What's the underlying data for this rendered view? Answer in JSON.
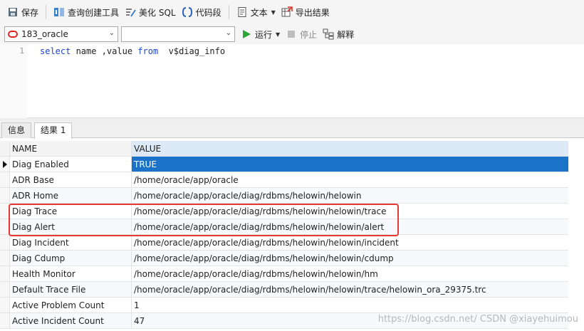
{
  "toolbar": {
    "save": "保存",
    "query_builder": "查询创建工具",
    "beautify_sql": "美化 SQL",
    "code_snippet": "代码段",
    "text": "文本",
    "export_results": "导出结果"
  },
  "toolbar2": {
    "connection": "183_oracle",
    "schema": "",
    "run": "运行",
    "stop": "停止",
    "explain": "解释"
  },
  "editor": {
    "line_number": "1",
    "tokens": [
      {
        "text": "select",
        "kw": true
      },
      {
        "text": " name ,value ",
        "kw": false
      },
      {
        "text": "from",
        "kw": true
      },
      {
        "text": "  v$diag_info",
        "kw": false
      }
    ]
  },
  "tabs": [
    {
      "label": "信息",
      "active": false
    },
    {
      "label": "结果 1",
      "active": true
    }
  ],
  "grid": {
    "columns": [
      "NAME",
      "VALUE"
    ],
    "rows": [
      {
        "name": "Diag Enabled",
        "value": "TRUE"
      },
      {
        "name": "ADR Base",
        "value": "/home/oracle/app/oracle"
      },
      {
        "name": "ADR Home",
        "value": "/home/oracle/app/oracle/diag/rdbms/helowin/helowin"
      },
      {
        "name": "Diag Trace",
        "value": "/home/oracle/app/oracle/diag/rdbms/helowin/helowin/trace"
      },
      {
        "name": "Diag Alert",
        "value": "/home/oracle/app/oracle/diag/rdbms/helowin/helowin/alert"
      },
      {
        "name": "Diag Incident",
        "value": "/home/oracle/app/oracle/diag/rdbms/helowin/helowin/incident"
      },
      {
        "name": "Diag Cdump",
        "value": "/home/oracle/app/oracle/diag/rdbms/helowin/helowin/cdump"
      },
      {
        "name": "Health Monitor",
        "value": "/home/oracle/app/oracle/diag/rdbms/helowin/helowin/hm"
      },
      {
        "name": "Default Trace File",
        "value": "/home/oracle/app/oracle/diag/rdbms/helowin/helowin/trace/helowin_ora_29375.trc"
      },
      {
        "name": "Active Problem Count",
        "value": "1"
      },
      {
        "name": "Active Incident Count",
        "value": "47"
      }
    ]
  },
  "watermark": "https://blog.csdn.net/  CSDN @xiayehuimou",
  "colors": {
    "selection": "#1a73c9",
    "highlight_box": "#e53935",
    "keyword": "#1a46d6",
    "run_icon": "#2aa63a"
  }
}
